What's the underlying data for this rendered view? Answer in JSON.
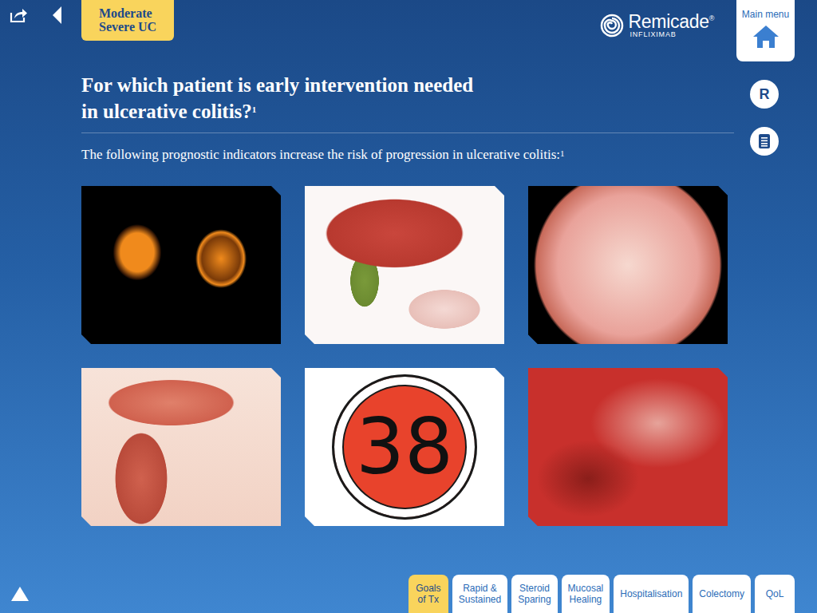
{
  "toolbar": {
    "tag": [
      "Moderate",
      "Severe UC"
    ]
  },
  "logo": {
    "name": "Remicade",
    "mark": "®",
    "subtitle": "INFLIXIMAB"
  },
  "main_menu": {
    "label": "Main menu"
  },
  "side_buttons": {
    "reference": "R"
  },
  "heading": {
    "lines": [
      "For which patient is early intervention needed",
      "in ulcerative colitis?"
    ],
    "footnote": "1"
  },
  "intro": {
    "text": "The following prognostic indicators increase the risk of progression in ulcerative colitis:",
    "footnote": "1"
  },
  "indicators": [
    {
      "kind": "scan",
      "color": "#f08a1c"
    },
    {
      "kind": "illustration",
      "color": "#c9463c"
    },
    {
      "kind": "endoscopy",
      "color": "#e9a29a"
    },
    {
      "kind": "diagram",
      "color": "#d0614e"
    },
    {
      "kind": "badge",
      "text": "38",
      "color": "#e8432c"
    },
    {
      "kind": "mucosa",
      "color": "#c8302c"
    }
  ],
  "tabs": [
    {
      "lines": [
        "Goals",
        "of Tx"
      ],
      "selected": true
    },
    {
      "lines": [
        "Rapid &",
        "Sustained"
      ],
      "selected": false
    },
    {
      "lines": [
        "Steroid",
        "Sparing"
      ],
      "selected": false
    },
    {
      "lines": [
        "Mucosal",
        "Healing"
      ],
      "selected": false
    },
    {
      "lines": [
        "Hospitalisation"
      ],
      "selected": false
    },
    {
      "lines": [
        "Colectomy"
      ],
      "selected": false
    },
    {
      "lines": [
        "QoL"
      ],
      "selected": false
    }
  ]
}
